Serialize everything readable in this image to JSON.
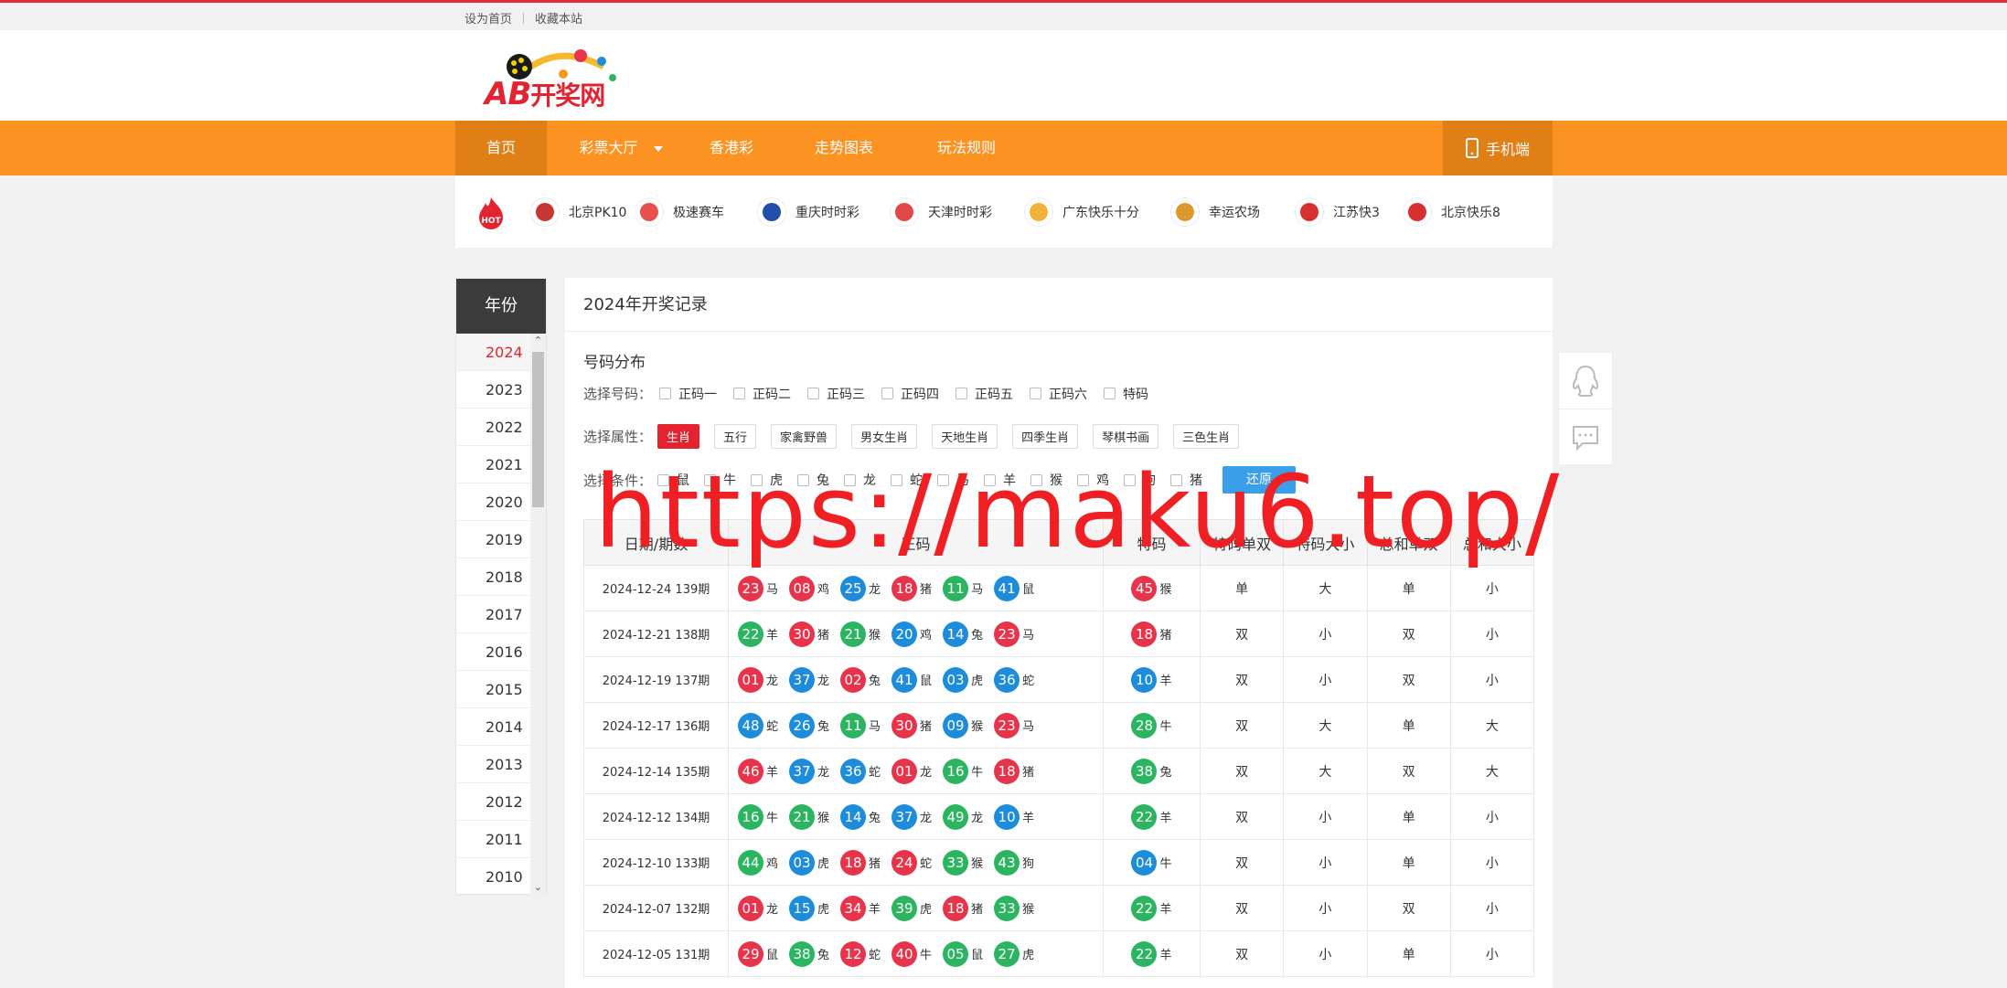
{
  "topbar": {
    "set_home": "设为首页",
    "bookmark": "收藏本站"
  },
  "logo": {
    "ab": "AB",
    "cn": "开奖网"
  },
  "nav": {
    "items": [
      "首页",
      "彩票大厅",
      "香港彩",
      "走势图表",
      "玩法规则"
    ],
    "mobile": "手机端"
  },
  "hot": {
    "games": [
      {
        "name": "北京PK10",
        "color": "#c73535"
      },
      {
        "name": "极速赛车",
        "color": "#e85050"
      },
      {
        "name": "重庆时时彩",
        "color": "#1f4fa8"
      },
      {
        "name": "天津时时彩",
        "color": "#e04848"
      },
      {
        "name": "广东快乐十分",
        "color": "#f1b23a"
      },
      {
        "name": "幸运农场",
        "color": "#d89a2b"
      },
      {
        "name": "江苏快3",
        "color": "#d63030"
      },
      {
        "name": "北京快乐8",
        "color": "#d63030"
      }
    ]
  },
  "side": {
    "title": "年份",
    "years": [
      "2024",
      "2023",
      "2022",
      "2021",
      "2020",
      "2019",
      "2018",
      "2017",
      "2016",
      "2015",
      "2014",
      "2013",
      "2012",
      "2011",
      "2010"
    ]
  },
  "main": {
    "title": "2024年开奖记录",
    "subtitle": "号码分布",
    "select_number_label": "选择号码：",
    "numbers": [
      "正码一",
      "正码二",
      "正码三",
      "正码四",
      "正码五",
      "正码六",
      "特码"
    ],
    "select_attr_label": "选择属性：",
    "attrs": [
      "生肖",
      "五行",
      "家禽野兽",
      "男女生肖",
      "天地生肖",
      "四季生肖",
      "琴棋书画",
      "三色生肖"
    ],
    "select_cond_label": "选择条件：",
    "conds": [
      "鼠",
      "牛",
      "虎",
      "兔",
      "龙",
      "蛇",
      "马",
      "羊",
      "猴",
      "鸡",
      "狗",
      "猪"
    ],
    "reset": "还原",
    "headers": [
      "日期/期数",
      "正码",
      "特码",
      "特码单双",
      "特码大小",
      "总和单双",
      "总和大小"
    ],
    "rows": [
      {
        "date": "2024-12-24 139期",
        "balls": [
          [
            "23",
            "马",
            "red"
          ],
          [
            "08",
            "鸡",
            "red"
          ],
          [
            "25",
            "龙",
            "blue"
          ],
          [
            "18",
            "猪",
            "red"
          ],
          [
            "11",
            "马",
            "green"
          ],
          [
            "41",
            "鼠",
            "blue"
          ]
        ],
        "special": [
          "45",
          "猴",
          "red"
        ],
        "sds": "单",
        "sdx": "大",
        "hds": "单",
        "hdx": "小"
      },
      {
        "date": "2024-12-21 138期",
        "balls": [
          [
            "22",
            "羊",
            "green"
          ],
          [
            "30",
            "猪",
            "red"
          ],
          [
            "21",
            "猴",
            "green"
          ],
          [
            "20",
            "鸡",
            "blue"
          ],
          [
            "14",
            "兔",
            "blue"
          ],
          [
            "23",
            "马",
            "red"
          ]
        ],
        "special": [
          "18",
          "猪",
          "red"
        ],
        "sds": "双",
        "sdx": "小",
        "hds": "双",
        "hdx": "小"
      },
      {
        "date": "2024-12-19 137期",
        "balls": [
          [
            "01",
            "龙",
            "red"
          ],
          [
            "37",
            "龙",
            "blue"
          ],
          [
            "02",
            "兔",
            "red"
          ],
          [
            "41",
            "鼠",
            "blue"
          ],
          [
            "03",
            "虎",
            "blue"
          ],
          [
            "36",
            "蛇",
            "blue"
          ]
        ],
        "special": [
          "10",
          "羊",
          "blue"
        ],
        "sds": "双",
        "sdx": "小",
        "hds": "双",
        "hdx": "小"
      },
      {
        "date": "2024-12-17 136期",
        "balls": [
          [
            "48",
            "蛇",
            "blue"
          ],
          [
            "26",
            "兔",
            "blue"
          ],
          [
            "11",
            "马",
            "green"
          ],
          [
            "30",
            "猪",
            "red"
          ],
          [
            "09",
            "猴",
            "blue"
          ],
          [
            "23",
            "马",
            "red"
          ]
        ],
        "special": [
          "28",
          "牛",
          "green"
        ],
        "sds": "双",
        "sdx": "大",
        "hds": "单",
        "hdx": "大"
      },
      {
        "date": "2024-12-14 135期",
        "balls": [
          [
            "46",
            "羊",
            "red"
          ],
          [
            "37",
            "龙",
            "blue"
          ],
          [
            "36",
            "蛇",
            "blue"
          ],
          [
            "01",
            "龙",
            "red"
          ],
          [
            "16",
            "牛",
            "green"
          ],
          [
            "18",
            "猪",
            "red"
          ]
        ],
        "special": [
          "38",
          "兔",
          "green"
        ],
        "sds": "双",
        "sdx": "大",
        "hds": "双",
        "hdx": "大"
      },
      {
        "date": "2024-12-12 134期",
        "balls": [
          [
            "16",
            "牛",
            "green"
          ],
          [
            "21",
            "猴",
            "green"
          ],
          [
            "14",
            "兔",
            "blue"
          ],
          [
            "37",
            "龙",
            "blue"
          ],
          [
            "49",
            "龙",
            "green"
          ],
          [
            "10",
            "羊",
            "blue"
          ]
        ],
        "special": [
          "22",
          "羊",
          "green"
        ],
        "sds": "双",
        "sdx": "小",
        "hds": "单",
        "hdx": "小"
      },
      {
        "date": "2024-12-10 133期",
        "balls": [
          [
            "44",
            "鸡",
            "green"
          ],
          [
            "03",
            "虎",
            "blue"
          ],
          [
            "18",
            "猪",
            "red"
          ],
          [
            "24",
            "蛇",
            "red"
          ],
          [
            "33",
            "猴",
            "green"
          ],
          [
            "43",
            "狗",
            "green"
          ]
        ],
        "special": [
          "04",
          "牛",
          "blue"
        ],
        "sds": "双",
        "sdx": "小",
        "hds": "单",
        "hdx": "小"
      },
      {
        "date": "2024-12-07 132期",
        "balls": [
          [
            "01",
            "龙",
            "red"
          ],
          [
            "15",
            "虎",
            "blue"
          ],
          [
            "34",
            "羊",
            "red"
          ],
          [
            "39",
            "虎",
            "green"
          ],
          [
            "18",
            "猪",
            "red"
          ],
          [
            "33",
            "猴",
            "green"
          ]
        ],
        "special": [
          "22",
          "羊",
          "green"
        ],
        "sds": "双",
        "sdx": "小",
        "hds": "双",
        "hdx": "小"
      },
      {
        "date": "2024-12-05 131期",
        "balls": [
          [
            "29",
            "鼠",
            "red"
          ],
          [
            "38",
            "兔",
            "green"
          ],
          [
            "12",
            "蛇",
            "red"
          ],
          [
            "40",
            "牛",
            "red"
          ],
          [
            "05",
            "鼠",
            "green"
          ],
          [
            "27",
            "虎",
            "green"
          ]
        ],
        "special": [
          "22",
          "羊",
          "green"
        ],
        "sds": "双",
        "sdx": "小",
        "hds": "单",
        "hdx": "小"
      }
    ]
  },
  "watermark": "https://maku6.top/"
}
